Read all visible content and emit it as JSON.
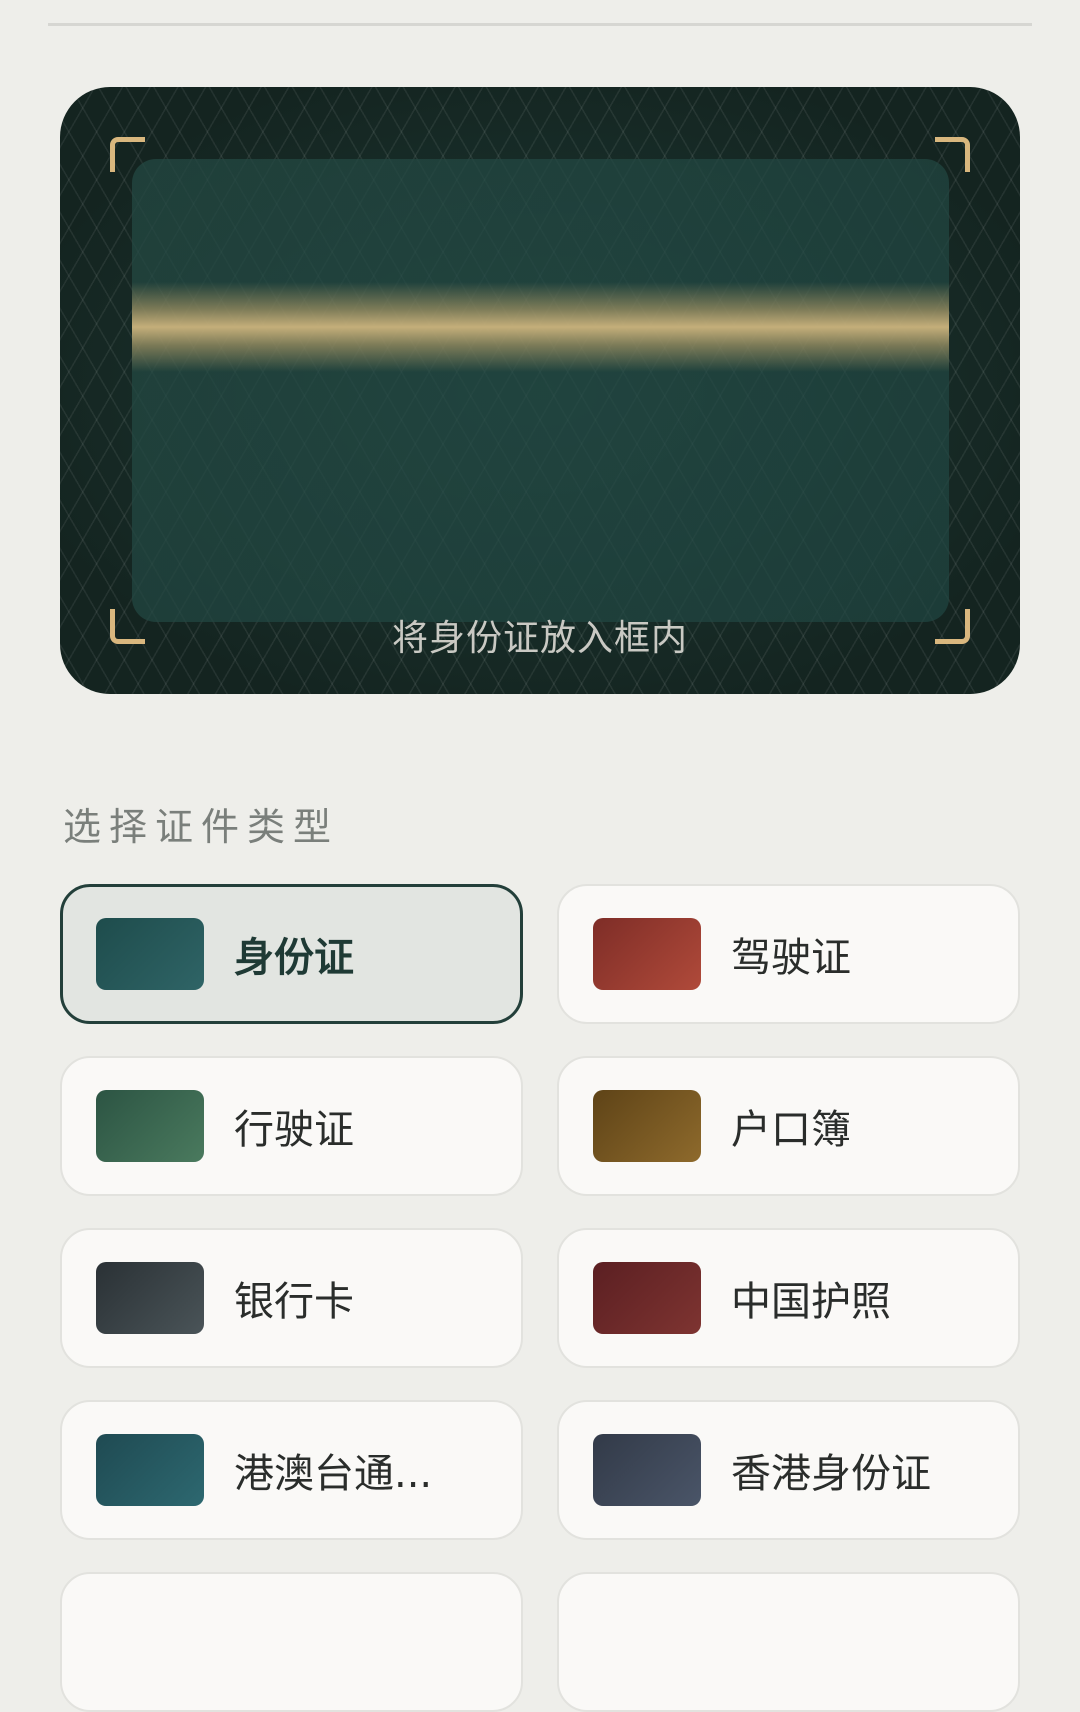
{
  "scanner": {
    "hint": "将身份证放入框内",
    "accent_color": "#D9B77E"
  },
  "doc_types": {
    "title": "选择证件类型",
    "items": [
      {
        "label": "身份证",
        "colors": [
          "#1E4C4C",
          "#2F6466"
        ],
        "selected": true
      },
      {
        "label": "驾驶证",
        "colors": [
          "#7E2D27",
          "#B04A3A"
        ],
        "selected": false
      },
      {
        "label": "行驶证",
        "colors": [
          "#2C5443",
          "#4A7A5E"
        ],
        "selected": false
      },
      {
        "label": "户口簿",
        "colors": [
          "#5E4317",
          "#8E6A2C"
        ],
        "selected": false
      },
      {
        "label": "银行卡",
        "colors": [
          "#2A3135",
          "#4A5458"
        ],
        "selected": false
      },
      {
        "label": "中国护照",
        "colors": [
          "#5B1F22",
          "#7E3431"
        ],
        "selected": false
      },
      {
        "label": "港澳台通...",
        "colors": [
          "#1F4A52",
          "#2D6870"
        ],
        "selected": false
      },
      {
        "label": "香港身份证",
        "colors": [
          "#323A48",
          "#4A5568"
        ],
        "selected": false
      },
      {
        "label": "",
        "colors": [
          "#FAF9F7",
          "#FAF9F7"
        ],
        "selected": false
      },
      {
        "label": "",
        "colors": [
          "#FAF9F7",
          "#FAF9F7"
        ],
        "selected": false
      }
    ]
  }
}
